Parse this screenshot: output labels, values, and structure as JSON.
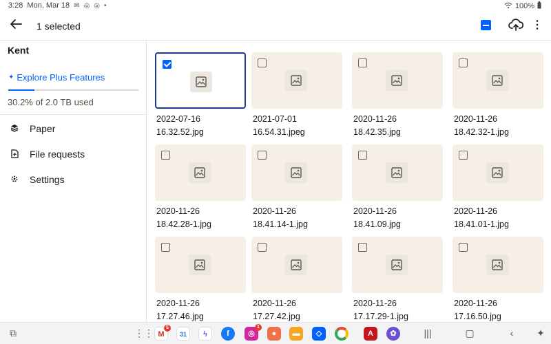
{
  "status_bar": {
    "time": "3:28",
    "date": "Mon, Mar 18",
    "battery": "100%"
  },
  "header": {
    "title": "1 selected"
  },
  "sidebar": {
    "account_name": "Kent",
    "explore_label": "Explore Plus Features",
    "usage_text": "30.2% of 2.0 TB used",
    "usage_fraction": 0.302,
    "items": [
      {
        "label": "Paper",
        "icon": "layers-icon"
      },
      {
        "label": "File requests",
        "icon": "file-request-icon"
      },
      {
        "label": "Settings",
        "icon": "gear-icon"
      }
    ]
  },
  "files": [
    {
      "line1": "2022-07-16",
      "line2": "16.32.52.jpg",
      "selected": true
    },
    {
      "line1": "2021-07-01",
      "line2": "16.54.31.jpeg",
      "selected": false
    },
    {
      "line1": "2020-11-26",
      "line2": "18.42.35.jpg",
      "selected": false
    },
    {
      "line1": "2020-11-26",
      "line2": "18.42.32-1.jpg",
      "selected": false
    },
    {
      "line1": "2020-11-26",
      "line2": "18.42.28-1.jpg",
      "selected": false
    },
    {
      "line1": "2020-11-26",
      "line2": "18.41.14-1.jpg",
      "selected": false
    },
    {
      "line1": "2020-11-26",
      "line2": "18.41.09.jpg",
      "selected": false
    },
    {
      "line1": "2020-11-26",
      "line2": "18.41.01-1.jpg",
      "selected": false
    },
    {
      "line1": "2020-11-26",
      "line2": "17.27.46.jpg",
      "selected": false
    },
    {
      "line1": "2020-11-26",
      "line2": "17.27.42.jpg",
      "selected": false
    },
    {
      "line1": "2020-11-26",
      "line2": "17.17.29-1.jpg",
      "selected": false
    },
    {
      "line1": "2020-11-26",
      "line2": "17.16.50.jpg",
      "selected": false
    }
  ],
  "taskbar": {
    "gmail_badge": "5",
    "instagram_badge": "1"
  },
  "colors": {
    "accent": "#0061fe",
    "thumb_bg": "#f5efe6",
    "selected_border": "#1e3a8a"
  }
}
